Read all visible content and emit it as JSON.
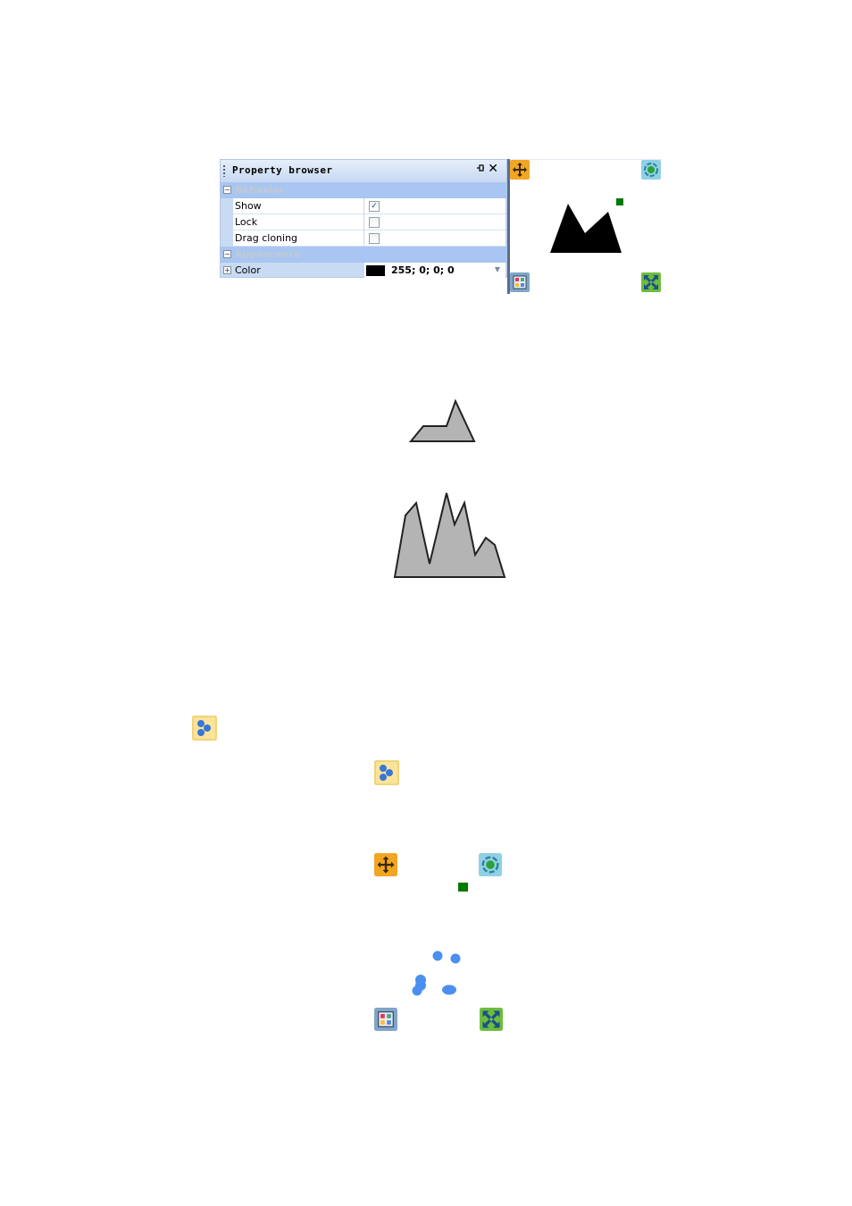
{
  "property_browser": {
    "title": "Property browser",
    "pin_icon": "pin-icon",
    "close_glyph": "✕",
    "categories": [
      {
        "label": "Behavior",
        "toggle": "−",
        "properties": [
          {
            "name": "Show",
            "checked": true,
            "check_glyph": "✓"
          },
          {
            "name": "Lock",
            "checked": false,
            "check_glyph": ""
          },
          {
            "name": "Drag cloning",
            "checked": false,
            "check_glyph": ""
          }
        ]
      },
      {
        "label": "Appearance",
        "toggle": "−",
        "properties": [
          {
            "name": "Color",
            "toggle": "+",
            "value": "255; 0; 0; 0",
            "swatch_color": "#000000"
          }
        ]
      }
    ]
  },
  "icons": {
    "move": "move-arrows-icon",
    "rotate": "rotate-icon",
    "properties": "properties-icon",
    "resize": "resize-icon",
    "dots": "blue-dots-icon"
  },
  "colors": {
    "handle_green": "#007a00",
    "shape_gray": "#b4b4b4",
    "scatter_blue": "#4b8ff0",
    "shape_black": "#000000"
  }
}
